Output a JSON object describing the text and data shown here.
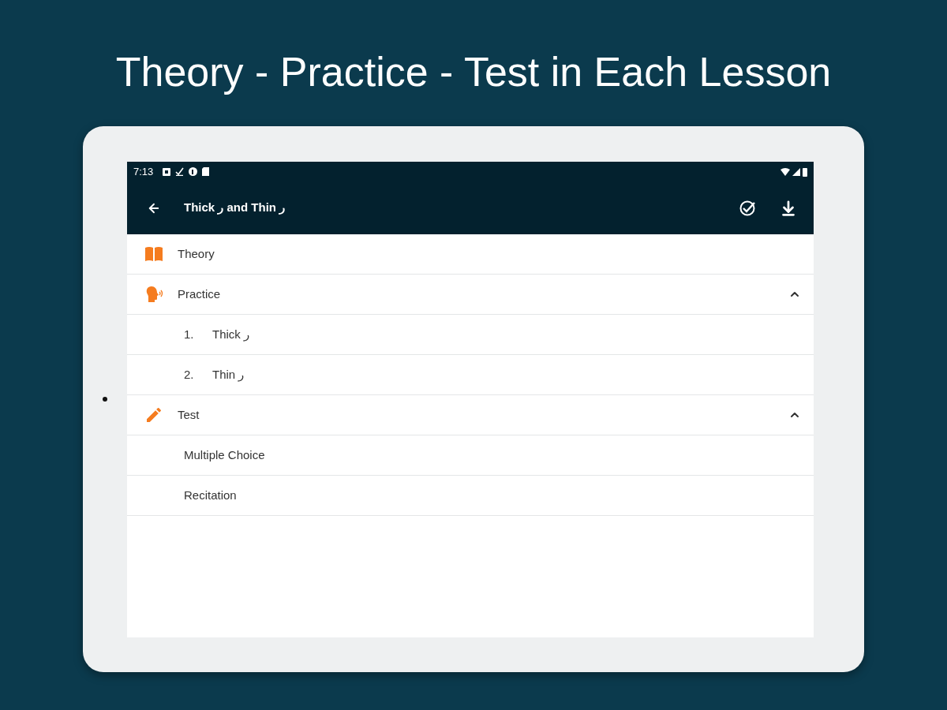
{
  "headline": "Theory - Practice - Test in Each Lesson",
  "status_bar": {
    "time": "7:13"
  },
  "app_bar": {
    "title": "Thick ر and Thin ر"
  },
  "sections": [
    {
      "kind": "theory",
      "label": "Theory"
    },
    {
      "kind": "practice",
      "label": "Practice",
      "expanded": true,
      "children": [
        {
          "number": "1.",
          "label": "Thick ر"
        },
        {
          "number": "2.",
          "label": "Thin ر"
        }
      ]
    },
    {
      "kind": "test",
      "label": "Test",
      "expanded": true,
      "children": [
        {
          "label": "Multiple Choice"
        },
        {
          "label": "Recitation"
        }
      ]
    }
  ]
}
